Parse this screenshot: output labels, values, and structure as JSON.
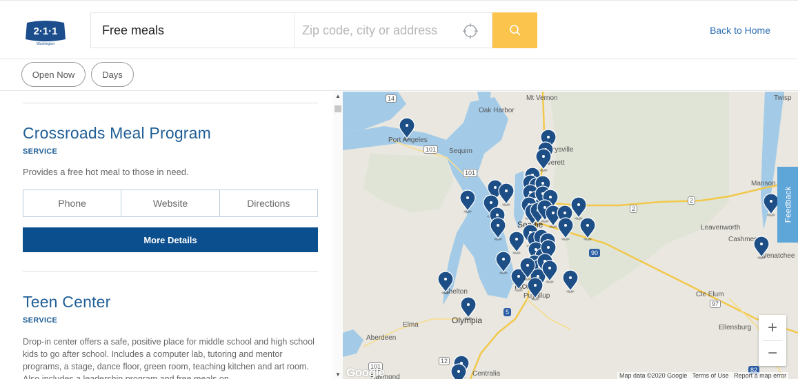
{
  "header": {
    "logo_text": "2·1·1",
    "logo_subtext": "Washington",
    "search_value": "Free meals",
    "location_placeholder": "Zip code, city or address",
    "back_home": "Back to Home"
  },
  "filters": {
    "pills": [
      "Open Now",
      "Days"
    ]
  },
  "results": [
    {
      "title": "Crossroads Meal Program",
      "type": "SERVICE",
      "description": "Provides a free hot meal to those in need.",
      "buttons": [
        "Phone",
        "Website",
        "Directions"
      ],
      "more_details": "More Details"
    },
    {
      "title": "Teen Center",
      "type": "SERVICE",
      "description": "Drop-in center offers a safe, positive place for middle school and high school kids to go after school. Includes a computer lab, tutoring and mentor programs, a stage, dance floor, green room, teaching kitchen and art room. Also includes a leadership program and free meals on"
    }
  ],
  "map": {
    "feedback_label": "Feedback",
    "zoom_in": "+",
    "zoom_out": "−",
    "google_logo": "Google",
    "footer": {
      "data": "Map data ©2020 Google",
      "terms": "Terms of Use",
      "report": "Report a map error"
    },
    "place_labels": [
      "Mt Vernon",
      "Twisp",
      "Oak Harbor",
      "Port Angeles",
      "Sequim",
      "Marysville",
      "Everett",
      "Manson",
      "Leavenworth",
      "Cashmere",
      "Wenatchee",
      "Seattle",
      "Tacoma",
      "Puyallup",
      "Shelton",
      "Olympia",
      "Elma",
      "Aberdeen",
      "Cle Elum",
      "Ellensburg",
      "Centralia",
      "Raymond"
    ],
    "road_shields": [
      "14",
      "101",
      "101",
      "2",
      "2",
      "90",
      "5",
      "97",
      "12",
      "101",
      "82"
    ],
    "colors": {
      "water": "#a3cbe8",
      "land": "#e9e7df",
      "marker": "#1d4f86",
      "accent": "#fbc44d",
      "brand_blue": "#0c4f8e"
    }
  }
}
